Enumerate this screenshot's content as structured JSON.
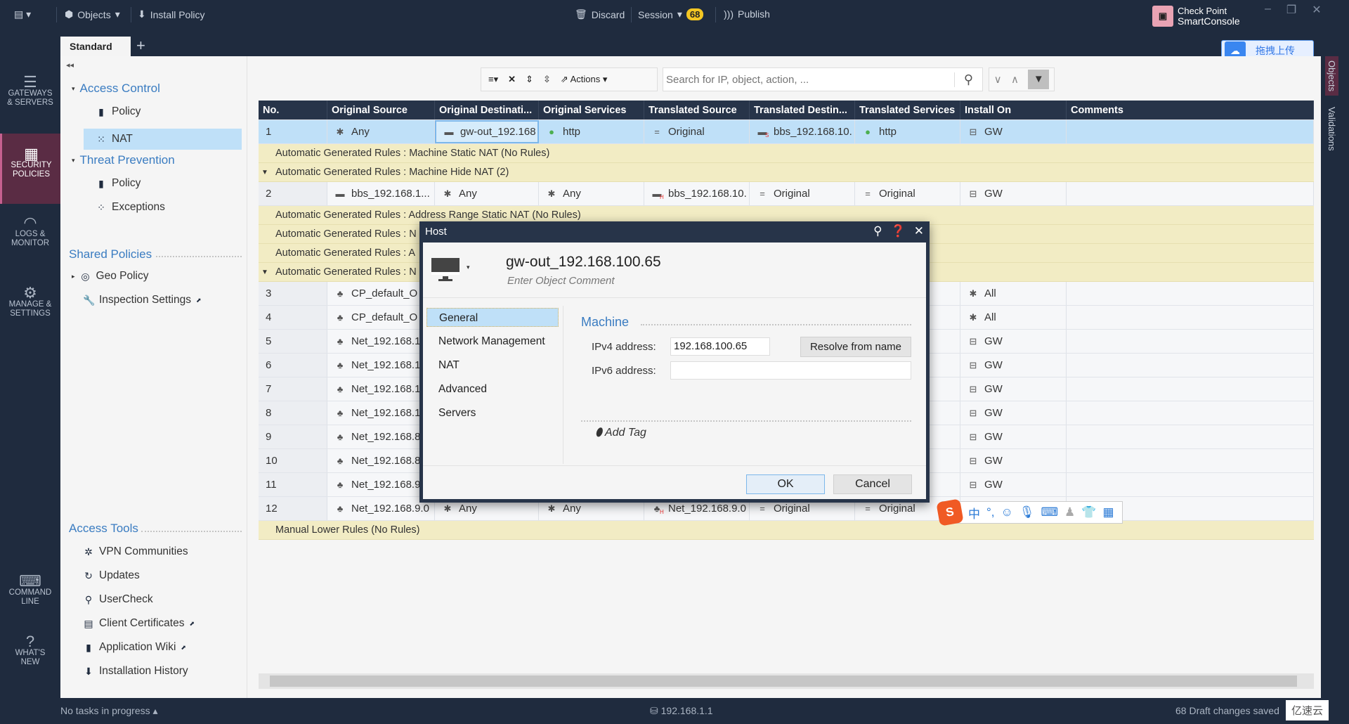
{
  "topbar": {
    "objects": "Objects",
    "install_policy": "Install Policy",
    "discard": "Discard",
    "session": "Session",
    "session_count": "68",
    "publish": "Publish",
    "brand_line1": "Check Point",
    "brand_line2": "SmartConsole"
  },
  "tabs": {
    "standard": "Standard",
    "add": "+"
  },
  "cloud_upload": "拖拽上传",
  "leftnav": [
    {
      "label1": "GATEWAYS",
      "label2": "& SERVERS",
      "icon": "server-icon"
    },
    {
      "label1": "SECURITY",
      "label2": "POLICIES",
      "icon": "firewall-icon",
      "active": true
    },
    {
      "label1": "LOGS &",
      "label2": "MONITOR",
      "icon": "gauge-icon"
    },
    {
      "label1": "MANAGE &",
      "label2": "SETTINGS",
      "icon": "gear-icon"
    },
    {
      "label1": "COMMAND",
      "label2": "LINE",
      "icon": "terminal-icon"
    },
    {
      "label1": "WHAT'S",
      "label2": "NEW",
      "icon": "question-icon"
    }
  ],
  "tree": {
    "access_control": "Access Control",
    "ac_policy": "Policy",
    "nat": "NAT",
    "threat_prevention": "Threat Prevention",
    "tp_policy": "Policy",
    "exceptions": "Exceptions",
    "shared_policies": "Shared Policies",
    "geo_policy": "Geo Policy",
    "inspection_settings": "Inspection Settings",
    "access_tools": "Access Tools",
    "vpn": "VPN Communities",
    "updates": "Updates",
    "usercheck": "UserCheck",
    "client_certs": "Client Certificates",
    "app_wiki": "Application Wiki",
    "install_history": "Installation History"
  },
  "toolbar": {
    "actions": "Actions",
    "search_placeholder": "Search for IP, object, action, ..."
  },
  "table": {
    "columns": [
      "No.",
      "Original Source",
      "Original Destinati...",
      "Original Services",
      "Translated Source",
      "Translated Destin...",
      "Translated Services",
      "Install On",
      "Comments"
    ],
    "items": [
      {
        "type": "rule",
        "no": "1",
        "selected": true,
        "cells": [
          [
            "asterisk",
            "Any"
          ],
          [
            "host",
            "gw-out_192.168"
          ],
          [
            "globe",
            "http"
          ],
          [
            "equals",
            "Original"
          ],
          [
            "host-s",
            "bbs_192.168.10."
          ],
          [
            "globe",
            "http"
          ],
          [
            "gateway",
            "GW"
          ],
          [
            "",
            ""
          ]
        ]
      },
      {
        "type": "section",
        "text": "Automatic Generated Rules : Machine Static NAT (No Rules)"
      },
      {
        "type": "section",
        "text": "Automatic Generated Rules : Machine Hide NAT (2)",
        "expanded": true
      },
      {
        "type": "rule",
        "no": "2",
        "cells": [
          [
            "host",
            "bbs_192.168.1..."
          ],
          [
            "asterisk",
            "Any"
          ],
          [
            "asterisk",
            "Any"
          ],
          [
            "host-h",
            "bbs_192.168.10."
          ],
          [
            "equals",
            "Original"
          ],
          [
            "equals",
            "Original"
          ],
          [
            "gateway",
            "GW"
          ],
          [
            "",
            ""
          ]
        ]
      },
      {
        "type": "section",
        "text": "Automatic Generated Rules : Address Range Static NAT (No Rules)"
      },
      {
        "type": "section",
        "text": "Automatic Generated Rules : N"
      },
      {
        "type": "section",
        "text": "Automatic Generated Rules : A"
      },
      {
        "type": "section",
        "text": "Automatic Generated Rules : N",
        "expanded": true
      },
      {
        "type": "rule",
        "no": "3",
        "cells": [
          [
            "network",
            "CP_default_O"
          ],
          [
            "",
            ""
          ],
          [
            "",
            ""
          ],
          [
            "",
            ""
          ],
          [
            "",
            ""
          ],
          [
            "",
            ""
          ],
          [
            "asterisk",
            "All"
          ],
          [
            "",
            ""
          ]
        ]
      },
      {
        "type": "rule",
        "no": "4",
        "cells": [
          [
            "network",
            "CP_default_O"
          ],
          [
            "",
            ""
          ],
          [
            "",
            ""
          ],
          [
            "",
            ""
          ],
          [
            "",
            ""
          ],
          [
            "",
            ""
          ],
          [
            "asterisk",
            "All"
          ],
          [
            "",
            ""
          ]
        ]
      },
      {
        "type": "rule",
        "no": "5",
        "cells": [
          [
            "network",
            "Net_192.168.1"
          ],
          [
            "",
            ""
          ],
          [
            "",
            ""
          ],
          [
            "",
            ""
          ],
          [
            "",
            ""
          ],
          [
            "",
            ""
          ],
          [
            "gateway",
            "GW"
          ],
          [
            "",
            ""
          ]
        ]
      },
      {
        "type": "rule",
        "no": "6",
        "cells": [
          [
            "network",
            "Net_192.168.1"
          ],
          [
            "",
            ""
          ],
          [
            "",
            ""
          ],
          [
            "",
            ""
          ],
          [
            "",
            ""
          ],
          [
            "",
            ""
          ],
          [
            "gateway",
            "GW"
          ],
          [
            "",
            ""
          ]
        ]
      },
      {
        "type": "rule",
        "no": "7",
        "cells": [
          [
            "network",
            "Net_192.168.1"
          ],
          [
            "",
            ""
          ],
          [
            "",
            ""
          ],
          [
            "",
            ""
          ],
          [
            "",
            ""
          ],
          [
            "",
            ""
          ],
          [
            "gateway",
            "GW"
          ],
          [
            "",
            ""
          ]
        ]
      },
      {
        "type": "rule",
        "no": "8",
        "cells": [
          [
            "network",
            "Net_192.168.1"
          ],
          [
            "",
            ""
          ],
          [
            "",
            ""
          ],
          [
            "",
            ""
          ],
          [
            "",
            ""
          ],
          [
            "",
            ""
          ],
          [
            "gateway",
            "GW"
          ],
          [
            "",
            ""
          ]
        ]
      },
      {
        "type": "rule",
        "no": "9",
        "cells": [
          [
            "network",
            "Net_192.168.8"
          ],
          [
            "",
            ""
          ],
          [
            "",
            ""
          ],
          [
            "",
            ""
          ],
          [
            "",
            ""
          ],
          [
            "",
            ""
          ],
          [
            "gateway",
            "GW"
          ],
          [
            "",
            ""
          ]
        ]
      },
      {
        "type": "rule",
        "no": "10",
        "cells": [
          [
            "network",
            "Net_192.168.8"
          ],
          [
            "",
            ""
          ],
          [
            "",
            ""
          ],
          [
            "",
            ""
          ],
          [
            "",
            ""
          ],
          [
            "",
            ""
          ],
          [
            "gateway",
            "GW"
          ],
          [
            "",
            ""
          ]
        ]
      },
      {
        "type": "rule",
        "no": "11",
        "cells": [
          [
            "network",
            "Net_192.168.9"
          ],
          [
            "",
            ""
          ],
          [
            "",
            ""
          ],
          [
            "",
            ""
          ],
          [
            "",
            ""
          ],
          [
            "",
            ""
          ],
          [
            "gateway",
            "GW"
          ],
          [
            "",
            ""
          ]
        ]
      },
      {
        "type": "rule",
        "no": "12",
        "cells": [
          [
            "network",
            "Net_192.168.9.0"
          ],
          [
            "asterisk",
            "Any"
          ],
          [
            "asterisk",
            "Any"
          ],
          [
            "network-h",
            "Net_192.168.9.0"
          ],
          [
            "equals",
            "Original"
          ],
          [
            "equals",
            "Original"
          ],
          [
            "",
            ""
          ],
          [
            "",
            ""
          ]
        ]
      },
      {
        "type": "section",
        "text": "Manual Lower Rules (No Rules)"
      }
    ]
  },
  "dialog": {
    "title": "Host",
    "name": "gw-out_192.168.100.65",
    "comment_placeholder": "Enter Object Comment",
    "nav": [
      "General",
      "Network Management",
      "NAT",
      "Advanced",
      "Servers"
    ],
    "section": "Machine",
    "ipv4_label": "IPv4 address:",
    "ipv4_value": "192.168.100.65",
    "ipv6_label": "IPv6 address:",
    "ipv6_value": "",
    "resolve": "Resolve from name",
    "add_tag": "Add Tag",
    "ok": "OK",
    "cancel": "Cancel"
  },
  "ime": {
    "mode": "中",
    "punct": "°,"
  },
  "rightbar": {
    "objects": "Objects",
    "validations": "Validations"
  },
  "status": {
    "tasks": "No tasks in progress",
    "server": "192.168.1.1",
    "drafts": "68 Draft changes saved",
    "watermark": "亿速云"
  }
}
